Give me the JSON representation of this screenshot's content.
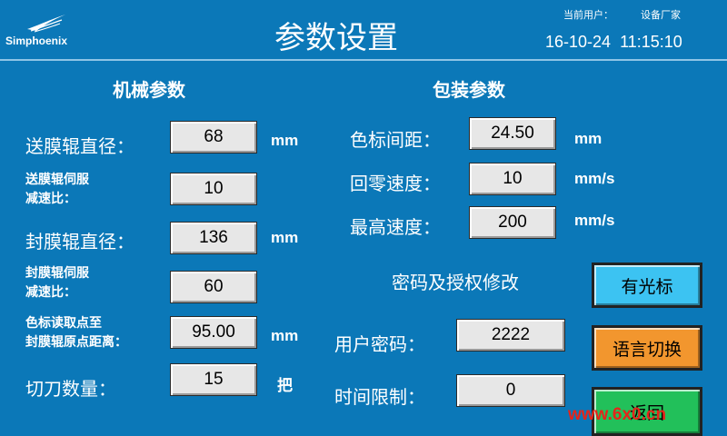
{
  "header": {
    "brand": "Simphoenix",
    "title": "参数设置",
    "user_label": "当前用户：",
    "user_value": "设备厂家",
    "date": "16-10-24",
    "time": "11:15:10"
  },
  "mechanical": {
    "title": "机械参数",
    "feed_roller_diameter": {
      "label": "送膜辊直径：",
      "value": "68",
      "unit": "mm"
    },
    "feed_servo_ratio": {
      "label_line1": "送膜辊伺服",
      "label_line2": "减速比：",
      "value": "10"
    },
    "seal_roller_diameter": {
      "label": "封膜辊直径：",
      "value": "136",
      "unit": "mm"
    },
    "seal_servo_ratio": {
      "label_line1": "封膜辊伺服",
      "label_line2": "减速比：",
      "value": "60"
    },
    "mark_distance": {
      "label_line1": "色标读取点至",
      "label_line2": "封膜辊原点距离：",
      "value": "95.00",
      "unit": "mm"
    },
    "cutter_count": {
      "label": "切刀数量：",
      "value": "15",
      "unit": "把"
    }
  },
  "packaging": {
    "title": "包装参数",
    "mark_spacing": {
      "label": "色标间距：",
      "value": "24.50",
      "unit": "mm"
    },
    "home_speed": {
      "label": "回零速度：",
      "value": "10",
      "unit": "mm/s"
    },
    "max_speed": {
      "label": "最高速度：",
      "value": "200",
      "unit": "mm/s"
    }
  },
  "password": {
    "title": "密码及授权修改",
    "user_password": {
      "label": "用户密码：",
      "value": "2222"
    },
    "time_limit": {
      "label": "时间限制：",
      "value": "0"
    }
  },
  "buttons": {
    "cursor": "有光标",
    "language": "语言切换",
    "back": "返回"
  },
  "watermark": "www.6x0.cn",
  "colors": {
    "background": "#0b78b8",
    "cursor_button": "#3cc3f2",
    "language_button": "#f2962e",
    "back_button": "#22c05a",
    "watermark": "#e6241a"
  }
}
